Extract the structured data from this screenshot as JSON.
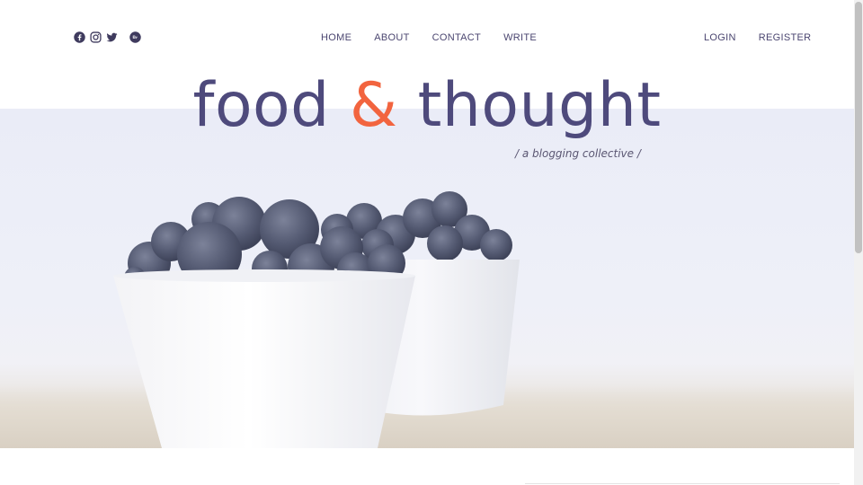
{
  "header": {
    "social_icons": [
      "facebook-icon",
      "instagram-icon",
      "twitter-icon",
      "bereal-icon"
    ],
    "nav_center": [
      "HOME",
      "ABOUT",
      "CONTACT",
      "WRITE"
    ],
    "nav_right": [
      "LOGIN",
      "REGISTER"
    ]
  },
  "hero": {
    "title_part1": "food ",
    "title_amp": "&",
    "title_part2": " thought",
    "tagline": "/ a blogging collective /"
  },
  "colors": {
    "accent": "#f2643f",
    "title": "#4e4a7c",
    "nav_text": "#4b4670",
    "hero_tint": "#eaecf7"
  }
}
